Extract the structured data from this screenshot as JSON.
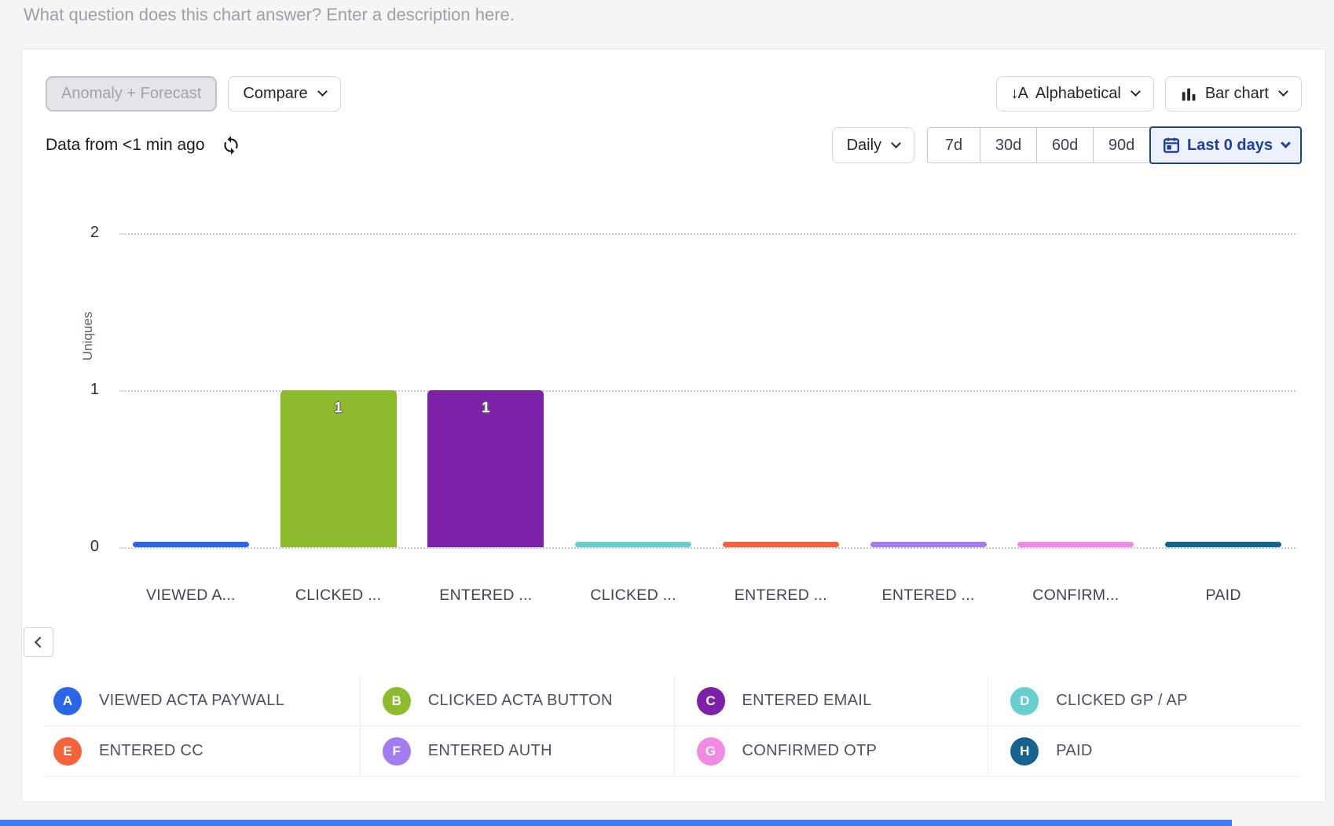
{
  "page": {
    "description_placeholder": "What question does this chart answer? Enter a description here.",
    "background_color": "#f5f5f6",
    "accent_strip_color": "#3d7cf5"
  },
  "toolbar": {
    "anomaly_forecast_label": "Anomaly + Forecast",
    "compare_label": "Compare",
    "sort_label": "Alphabetical",
    "sort_icon": "arrow-down-a-icon",
    "chart_type_label": "Bar chart",
    "chart_type_icon": "bar-chart-icon"
  },
  "controls": {
    "data_freshness": "Data from <1 min ago",
    "refresh_icon": "refresh-icon",
    "granularity_label": "Daily",
    "range_options": [
      "7d",
      "30d",
      "60d",
      "90d"
    ],
    "selected_range": {
      "label": "Last 0 days",
      "icon": "calendar-icon",
      "color": "#1e3f9e"
    }
  },
  "chart_data": {
    "type": "bar",
    "title": "",
    "ylabel": "Uniques",
    "xlabel": "",
    "ylim": [
      0,
      2
    ],
    "yticks": [
      0,
      1,
      2
    ],
    "grid": "dotted-horizontal",
    "legend_position": "bottom",
    "categories": [
      "VIEWED A...",
      "CLICKED ...",
      "ENTERED ...",
      "CLICKED ...",
      "ENTERED ...",
      "ENTERED ...",
      "CONFIRM...",
      "PAID"
    ],
    "values": [
      0,
      1,
      1,
      0,
      0,
      0,
      0,
      0
    ],
    "bar_labels": [
      "",
      "1",
      "1",
      "",
      "",
      "",
      "",
      ""
    ],
    "colors": [
      "#2b66e8",
      "#8dbb2d",
      "#7c21a8",
      "#69cccf",
      "#f4633c",
      "#a47cf2",
      "#f18ae2",
      "#16638f"
    ]
  },
  "legend": {
    "items": [
      {
        "letter": "A",
        "label": "VIEWED ACTA PAYWALL",
        "color": "#2b66e8"
      },
      {
        "letter": "B",
        "label": "CLICKED ACTA BUTTON",
        "color": "#8dbb2d"
      },
      {
        "letter": "C",
        "label": "ENTERED EMAIL",
        "color": "#7c21a8"
      },
      {
        "letter": "D",
        "label": "CLICKED GP / AP",
        "color": "#69cccf"
      },
      {
        "letter": "E",
        "label": "ENTERED CC",
        "color": "#f4633c"
      },
      {
        "letter": "F",
        "label": "ENTERED AUTH",
        "color": "#a47cf2"
      },
      {
        "letter": "G",
        "label": "CONFIRMED OTP",
        "color": "#f18ae2"
      },
      {
        "letter": "H",
        "label": "PAID",
        "color": "#16638f"
      }
    ]
  },
  "panel": {
    "collapse_icon": "chevron-left-icon"
  }
}
